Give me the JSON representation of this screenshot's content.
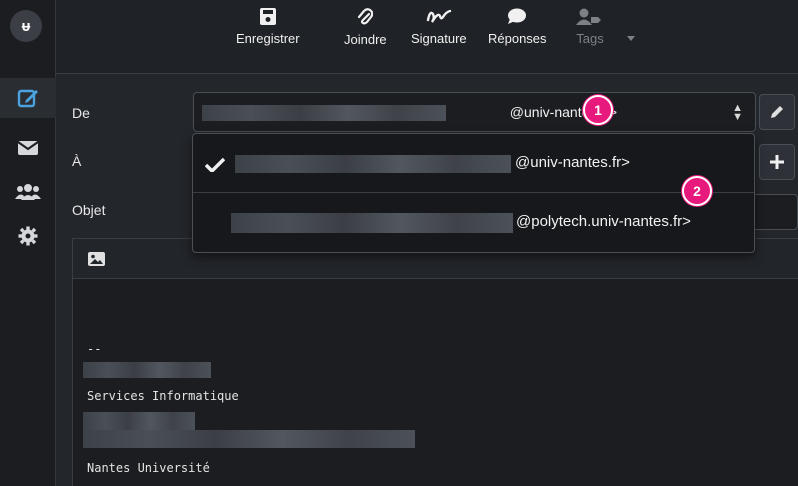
{
  "app": {
    "logo_text": "ᵾ"
  },
  "rail": {
    "items": [
      {
        "icon": "compose-icon",
        "active": true
      },
      {
        "icon": "mail-icon",
        "active": false
      },
      {
        "icon": "contacts-icon",
        "active": false
      },
      {
        "icon": "settings-icon",
        "active": false
      }
    ]
  },
  "toolbar": {
    "save_label": "Enregistrer",
    "attach_label": "Joindre",
    "signature_label": "Signature",
    "responses_label": "Réponses",
    "tags_label": "Tags"
  },
  "compose": {
    "from_label": "De",
    "to_label": "À",
    "subject_label": "Objet",
    "from_value_suffix": "@univ-nantes.fr>"
  },
  "dropdown": {
    "options": [
      {
        "suffix": "@univ-nantes.fr>",
        "selected": true
      },
      {
        "suffix": "@polytech.univ-nantes.fr>",
        "selected": false
      }
    ]
  },
  "badges": {
    "one": "1",
    "two": "2"
  },
  "editor": {
    "sig_separator": "--",
    "sig_line_services": "Services Informatique",
    "sig_line_university": "Nantes Université"
  },
  "colors": {
    "badge": "#e8197d",
    "accent_active": "#4aa3df"
  }
}
